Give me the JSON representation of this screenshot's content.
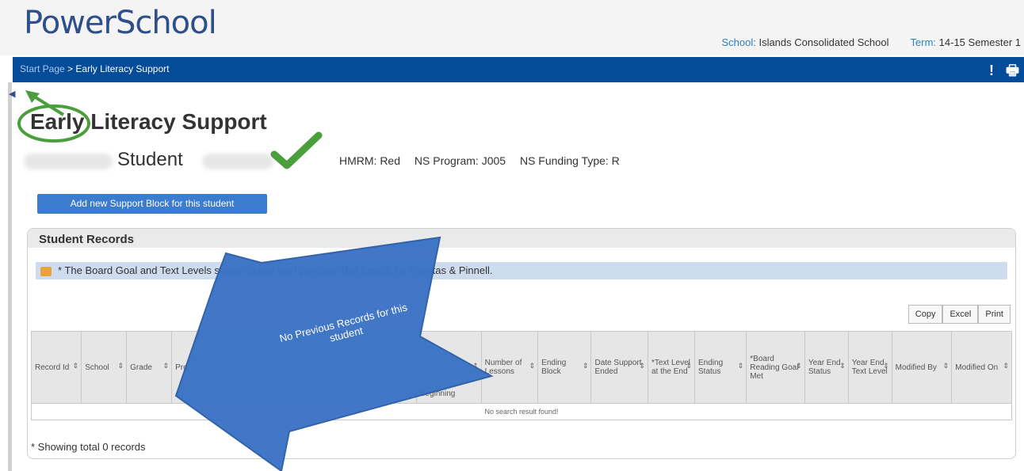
{
  "header": {
    "logo": "PowerSchool",
    "school_label": "School:",
    "school_value": "Islands Consolidated School",
    "term_label": "Term:",
    "term_value": "14-15 Semester 1"
  },
  "nav": {
    "breadcrumb_start": "Start Page",
    "breadcrumb_sep": ">",
    "breadcrumb_current": "Early Literacy Support",
    "alert_icon": "!",
    "print_icon": "🖶"
  },
  "page": {
    "title": "Early Literacy Support",
    "student_name": "Student",
    "hmrm": "HMRM: Red",
    "ns_program": "NS Program: J005",
    "ns_funding": "NS Funding Type: R",
    "add_button": "Add new Support Block for this student"
  },
  "records": {
    "title": "Student Records",
    "notice": "* The Board Goal and Text Levels shown below are l                     pendent Text Levels for Fountas & Pinnell.",
    "buttons": [
      "Copy",
      "Excel",
      "Print"
    ],
    "columns": [
      "Record Id",
      "School",
      "Grade",
      "Pro",
      "",
      "Beginning",
      "Number of Lessons",
      "Ending Block",
      "Date Support Ended",
      "*Text Level at the End",
      "Ending Status",
      "*Board Reading Goal Met",
      "Year End Status",
      "Year End Text Level",
      "Modified By",
      "Modified On"
    ],
    "empty_message": "No search result found!",
    "showing": "* Showing total 0 records"
  },
  "annotation": {
    "arrow_text_1": "No Previous Records for this",
    "arrow_text_2": "student"
  },
  "colors": {
    "nav_bar": "#044b9a",
    "add_button": "#3c7ccf",
    "arrow": "#3b73c5",
    "highlight": "#4a9f3c"
  }
}
